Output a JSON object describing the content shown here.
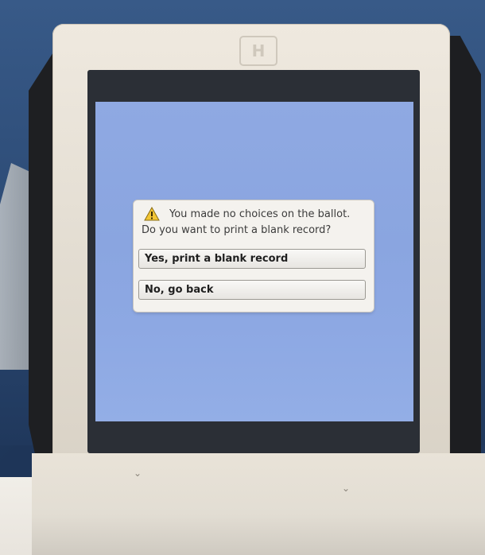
{
  "dialog": {
    "icon": "warning-icon",
    "message_line1": "You made no choices on the ballot.",
    "message_line2": "Do you want to print a blank record?",
    "yes_label": "Yes, print a blank record",
    "no_label": "No, go back"
  },
  "device": {
    "logo_text": "H",
    "screen_color": "#8ea9e3",
    "bezel_color": "#e8e2d7"
  }
}
